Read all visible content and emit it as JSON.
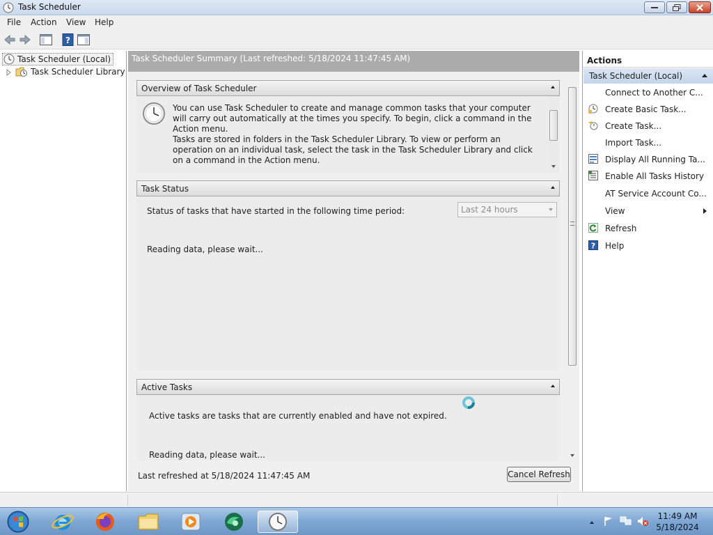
{
  "window": {
    "title": "Task Scheduler"
  },
  "menu": {
    "items": [
      "File",
      "Action",
      "View",
      "Help"
    ]
  },
  "tree": {
    "root": "Task Scheduler (Local)",
    "child": "Task Scheduler Library"
  },
  "center": {
    "header": "Task Scheduler Summary (Last refreshed: 5/18/2024 11:47:45 AM)",
    "overview": {
      "title": "Overview of Task Scheduler",
      "para1": "You can use Task Scheduler to create and manage common tasks that your computer will carry out automatically at the times you specify. To begin, click a command in the Action menu.",
      "para2": "Tasks are stored in folders in the Task Scheduler Library. To view or perform an operation on an individual task, select the task in the Task Scheduler Library and click on a command in the Action menu."
    },
    "task_status": {
      "title": "Task Status",
      "period_label": "Status of tasks that have started in the following time period:",
      "period_value": "Last 24 hours",
      "loading": "Reading data, please wait..."
    },
    "active_tasks": {
      "title": "Active Tasks",
      "description": "Active tasks are tasks that are currently enabled and have not expired.",
      "loading": "Reading data, please wait..."
    },
    "footer": {
      "last_refreshed": "Last refreshed at 5/18/2024 11:47:45 AM",
      "cancel_button": "Cancel Refresh"
    }
  },
  "actions": {
    "title": "Actions",
    "group": "Task Scheduler (Local)",
    "items": [
      {
        "label": "Connect to Another C...",
        "icon": "none"
      },
      {
        "label": "Create Basic Task...",
        "icon": "basic-task-icon"
      },
      {
        "label": "Create Task...",
        "icon": "create-task-icon"
      },
      {
        "label": "Import Task...",
        "icon": "none"
      },
      {
        "label": "Display All Running Ta...",
        "icon": "running-tasks-icon"
      },
      {
        "label": "Enable All Tasks History",
        "icon": "history-icon"
      },
      {
        "label": "AT Service Account Co...",
        "icon": "none"
      },
      {
        "label": "View",
        "icon": "none"
      },
      {
        "label": "Refresh",
        "icon": "refresh-icon"
      },
      {
        "label": "Help",
        "icon": "help-icon"
      }
    ]
  },
  "taskbar": {
    "clock_time": "11:49 AM",
    "clock_date": "5/18/2024"
  },
  "colors": {
    "accent_header": "#ababab",
    "actions_group_bg": "#c3d5ea",
    "taskbar": "#7fa7d3"
  }
}
